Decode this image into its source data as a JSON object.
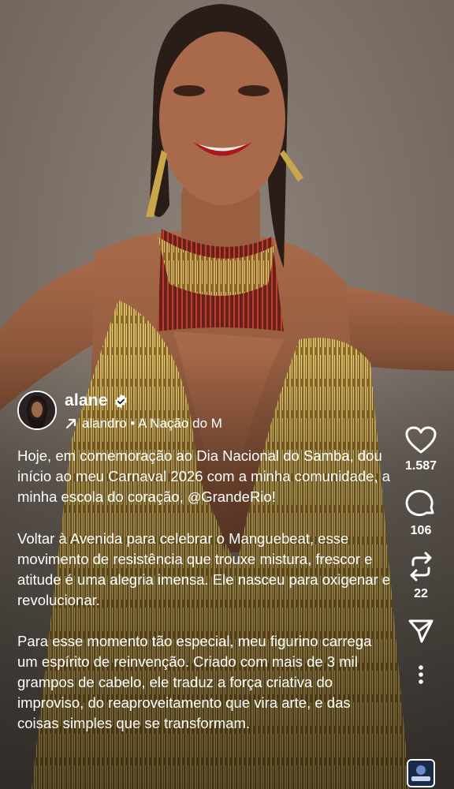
{
  "post": {
    "username": "alane",
    "audio": "alandro • A Nação do M"
  },
  "caption": {
    "p1_text": "Hoje, em comemoração ao Dia Nacional do Samba, dou início ao meu Carnaval 2026 com a minha comunidade, a minha escola do coração,",
    "p1_mention": "GrandeRio",
    "p1_end": "!",
    "p2": "Voltar à Avenida para celebrar o Manguebeat, esse movimento de resistência que trouxe mistura, frescor e atitude é uma alegria imensa. Ele nasceu para oxigenar e revolucionar.",
    "p3": "Para esse momento tão especial, meu figurino carrega um espírito de reinvenção. Criado com mais de 3 mil grampos de cabelo, ele traduz a força criativa do improviso, do reaproveitamento que vira arte, e das coisas simples que se transformam."
  },
  "actions": {
    "likes": "1.587",
    "comments": "106",
    "reposts": "22"
  },
  "icons": {
    "verified": "verified-badge-icon",
    "audio": "arrow-up-right-icon",
    "like": "heart-icon",
    "comment": "comment-bubble-icon",
    "repost": "repost-icon",
    "share": "send-icon",
    "more": "more-vertical-icon",
    "threads": "threads-icon"
  },
  "colors": {
    "text": "#ffffff",
    "background": "#7a6f66",
    "costume_gold": "#c9a64a",
    "costume_red": "#8a2a22",
    "lipstick": "#b0141c"
  }
}
